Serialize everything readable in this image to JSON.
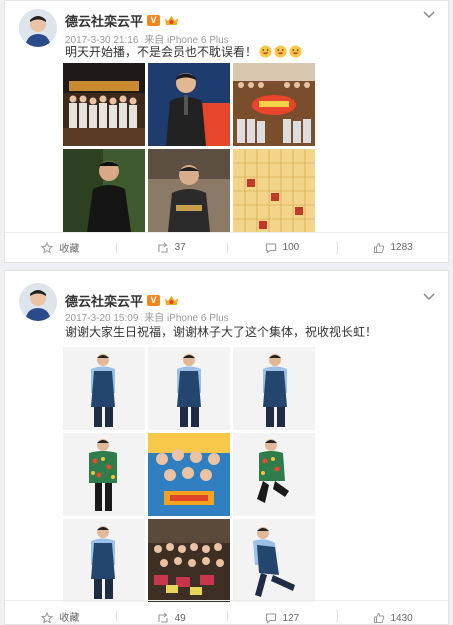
{
  "posts": [
    {
      "author": "德云社栾云平",
      "timestamp": "2017-3-30 21:16",
      "source": "来自 iPhone 6 Plus",
      "text": "明天开始播，不是会员也不耽误看！",
      "emoji_count": 3,
      "actions": {
        "favorite": "收藏",
        "repost": "37",
        "comment": "100",
        "like": "1283"
      }
    },
    {
      "author": "德云社栾云平",
      "timestamp": "2017-3-20 15:09",
      "source": "来自 iPhone 6 Plus",
      "text": "谢谢大家生日祝福，谢谢林子大了这个集体，祝收视长虹！",
      "actions": {
        "favorite": "收藏",
        "repost": "49",
        "comment": "127",
        "like": "1430"
      }
    }
  ],
  "icons": {
    "avatar": "avatar-icon",
    "vip": "vip-badge-icon",
    "member": "member-crown-icon",
    "menu": "chevron-down-icon",
    "favorite": "star-icon",
    "repost": "repost-icon",
    "comment": "comment-icon",
    "like": "thumbs-up-icon"
  },
  "colors": {
    "vip": "#f1881e",
    "text": "#333333",
    "meta": "#999999",
    "background": "#eef0f3"
  }
}
